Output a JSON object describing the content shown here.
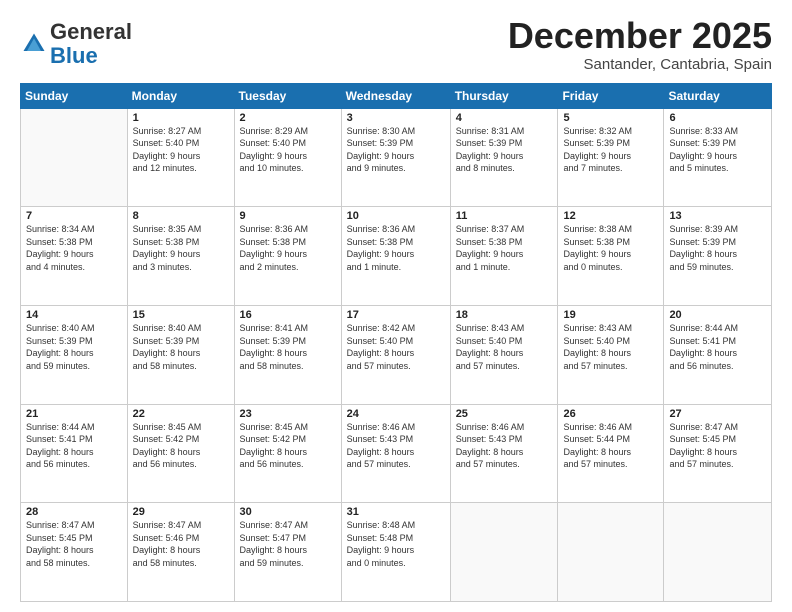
{
  "logo": {
    "general": "General",
    "blue": "Blue"
  },
  "header": {
    "month": "December 2025",
    "location": "Santander, Cantabria, Spain"
  },
  "weekdays": [
    "Sunday",
    "Monday",
    "Tuesday",
    "Wednesday",
    "Thursday",
    "Friday",
    "Saturday"
  ],
  "weeks": [
    [
      {
        "day": "",
        "info": ""
      },
      {
        "day": "1",
        "info": "Sunrise: 8:27 AM\nSunset: 5:40 PM\nDaylight: 9 hours\nand 12 minutes."
      },
      {
        "day": "2",
        "info": "Sunrise: 8:29 AM\nSunset: 5:40 PM\nDaylight: 9 hours\nand 10 minutes."
      },
      {
        "day": "3",
        "info": "Sunrise: 8:30 AM\nSunset: 5:39 PM\nDaylight: 9 hours\nand 9 minutes."
      },
      {
        "day": "4",
        "info": "Sunrise: 8:31 AM\nSunset: 5:39 PM\nDaylight: 9 hours\nand 8 minutes."
      },
      {
        "day": "5",
        "info": "Sunrise: 8:32 AM\nSunset: 5:39 PM\nDaylight: 9 hours\nand 7 minutes."
      },
      {
        "day": "6",
        "info": "Sunrise: 8:33 AM\nSunset: 5:39 PM\nDaylight: 9 hours\nand 5 minutes."
      }
    ],
    [
      {
        "day": "7",
        "info": "Sunrise: 8:34 AM\nSunset: 5:38 PM\nDaylight: 9 hours\nand 4 minutes."
      },
      {
        "day": "8",
        "info": "Sunrise: 8:35 AM\nSunset: 5:38 PM\nDaylight: 9 hours\nand 3 minutes."
      },
      {
        "day": "9",
        "info": "Sunrise: 8:36 AM\nSunset: 5:38 PM\nDaylight: 9 hours\nand 2 minutes."
      },
      {
        "day": "10",
        "info": "Sunrise: 8:36 AM\nSunset: 5:38 PM\nDaylight: 9 hours\nand 1 minute."
      },
      {
        "day": "11",
        "info": "Sunrise: 8:37 AM\nSunset: 5:38 PM\nDaylight: 9 hours\nand 1 minute."
      },
      {
        "day": "12",
        "info": "Sunrise: 8:38 AM\nSunset: 5:38 PM\nDaylight: 9 hours\nand 0 minutes."
      },
      {
        "day": "13",
        "info": "Sunrise: 8:39 AM\nSunset: 5:39 PM\nDaylight: 8 hours\nand 59 minutes."
      }
    ],
    [
      {
        "day": "14",
        "info": "Sunrise: 8:40 AM\nSunset: 5:39 PM\nDaylight: 8 hours\nand 59 minutes."
      },
      {
        "day": "15",
        "info": "Sunrise: 8:40 AM\nSunset: 5:39 PM\nDaylight: 8 hours\nand 58 minutes."
      },
      {
        "day": "16",
        "info": "Sunrise: 8:41 AM\nSunset: 5:39 PM\nDaylight: 8 hours\nand 58 minutes."
      },
      {
        "day": "17",
        "info": "Sunrise: 8:42 AM\nSunset: 5:40 PM\nDaylight: 8 hours\nand 57 minutes."
      },
      {
        "day": "18",
        "info": "Sunrise: 8:43 AM\nSunset: 5:40 PM\nDaylight: 8 hours\nand 57 minutes."
      },
      {
        "day": "19",
        "info": "Sunrise: 8:43 AM\nSunset: 5:40 PM\nDaylight: 8 hours\nand 57 minutes."
      },
      {
        "day": "20",
        "info": "Sunrise: 8:44 AM\nSunset: 5:41 PM\nDaylight: 8 hours\nand 56 minutes."
      }
    ],
    [
      {
        "day": "21",
        "info": "Sunrise: 8:44 AM\nSunset: 5:41 PM\nDaylight: 8 hours\nand 56 minutes."
      },
      {
        "day": "22",
        "info": "Sunrise: 8:45 AM\nSunset: 5:42 PM\nDaylight: 8 hours\nand 56 minutes."
      },
      {
        "day": "23",
        "info": "Sunrise: 8:45 AM\nSunset: 5:42 PM\nDaylight: 8 hours\nand 56 minutes."
      },
      {
        "day": "24",
        "info": "Sunrise: 8:46 AM\nSunset: 5:43 PM\nDaylight: 8 hours\nand 57 minutes."
      },
      {
        "day": "25",
        "info": "Sunrise: 8:46 AM\nSunset: 5:43 PM\nDaylight: 8 hours\nand 57 minutes."
      },
      {
        "day": "26",
        "info": "Sunrise: 8:46 AM\nSunset: 5:44 PM\nDaylight: 8 hours\nand 57 minutes."
      },
      {
        "day": "27",
        "info": "Sunrise: 8:47 AM\nSunset: 5:45 PM\nDaylight: 8 hours\nand 57 minutes."
      }
    ],
    [
      {
        "day": "28",
        "info": "Sunrise: 8:47 AM\nSunset: 5:45 PM\nDaylight: 8 hours\nand 58 minutes."
      },
      {
        "day": "29",
        "info": "Sunrise: 8:47 AM\nSunset: 5:46 PM\nDaylight: 8 hours\nand 58 minutes."
      },
      {
        "day": "30",
        "info": "Sunrise: 8:47 AM\nSunset: 5:47 PM\nDaylight: 8 hours\nand 59 minutes."
      },
      {
        "day": "31",
        "info": "Sunrise: 8:48 AM\nSunset: 5:48 PM\nDaylight: 9 hours\nand 0 minutes."
      },
      {
        "day": "",
        "info": ""
      },
      {
        "day": "",
        "info": ""
      },
      {
        "day": "",
        "info": ""
      }
    ]
  ]
}
